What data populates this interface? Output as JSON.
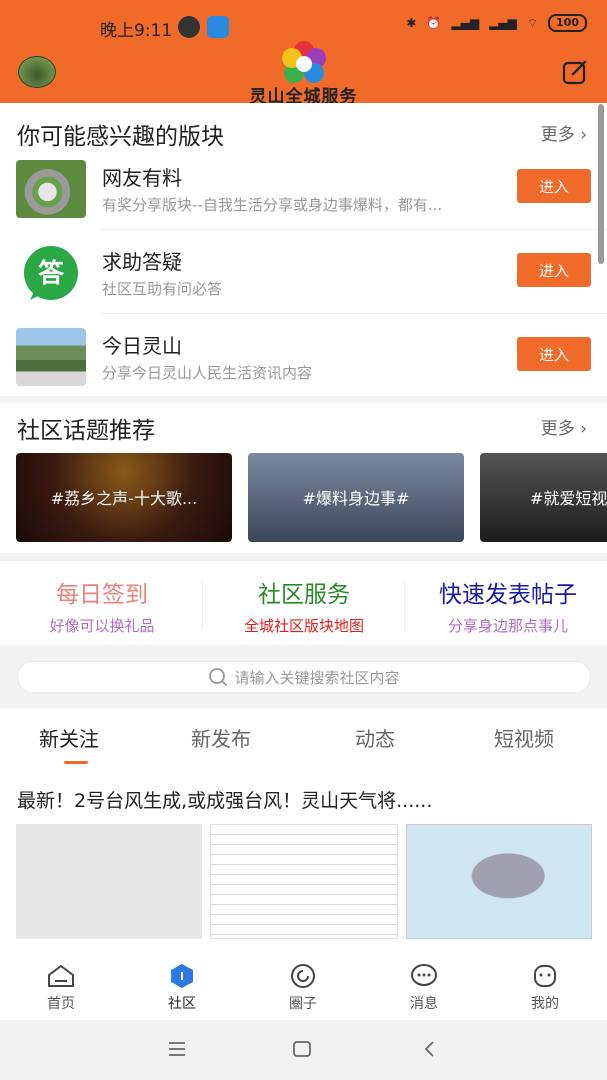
{
  "status": {
    "time": "晚上9:11",
    "battery": "100"
  },
  "header": {
    "title": "灵山全城服务"
  },
  "interests": {
    "title": "你可能感兴趣的版块",
    "more": "更多",
    "items": [
      {
        "name": "网友有料",
        "desc": "有奖分享版块--自我生活分享或身边事爆料，都有...",
        "button": "进入"
      },
      {
        "name": "求助答疑",
        "desc": "社区互助有问必答",
        "button": "进入",
        "icon_text": "答"
      },
      {
        "name": "今日灵山",
        "desc": "分享今日灵山人民生活资讯内容",
        "button": "进入"
      }
    ]
  },
  "topics": {
    "title": "社区话题推荐",
    "more": "更多",
    "items": [
      {
        "label": "#荔乡之声-十大歌..."
      },
      {
        "label": "#爆料身边事#"
      },
      {
        "label": "#就爱短视"
      }
    ]
  },
  "quick": [
    {
      "title": "每日签到",
      "sub": "好像可以换礼品",
      "title_color": "#e8837a",
      "sub_color": "#b06ec0"
    },
    {
      "title": "社区服务",
      "sub": "全城社区版块地图",
      "title_color": "#2a8a2a",
      "sub_color": "#e02020"
    },
    {
      "title": "快速发表帖子",
      "sub": "分享身边那点事儿",
      "title_color": "#1a1aa0",
      "sub_color": "#b06ec0"
    }
  ],
  "search": {
    "placeholder": "请输入关键搜索社区内容"
  },
  "tabs": [
    "新关注",
    "新发布",
    "动态",
    "短视频"
  ],
  "news": {
    "title": "最新！2号台风生成,或成强台风！灵山天气将......"
  },
  "bottom_nav": [
    {
      "label": "首页"
    },
    {
      "label": "社区"
    },
    {
      "label": "圈子"
    },
    {
      "label": "消息"
    },
    {
      "label": "我的"
    }
  ],
  "colors": {
    "brand": "#f06a2a"
  }
}
